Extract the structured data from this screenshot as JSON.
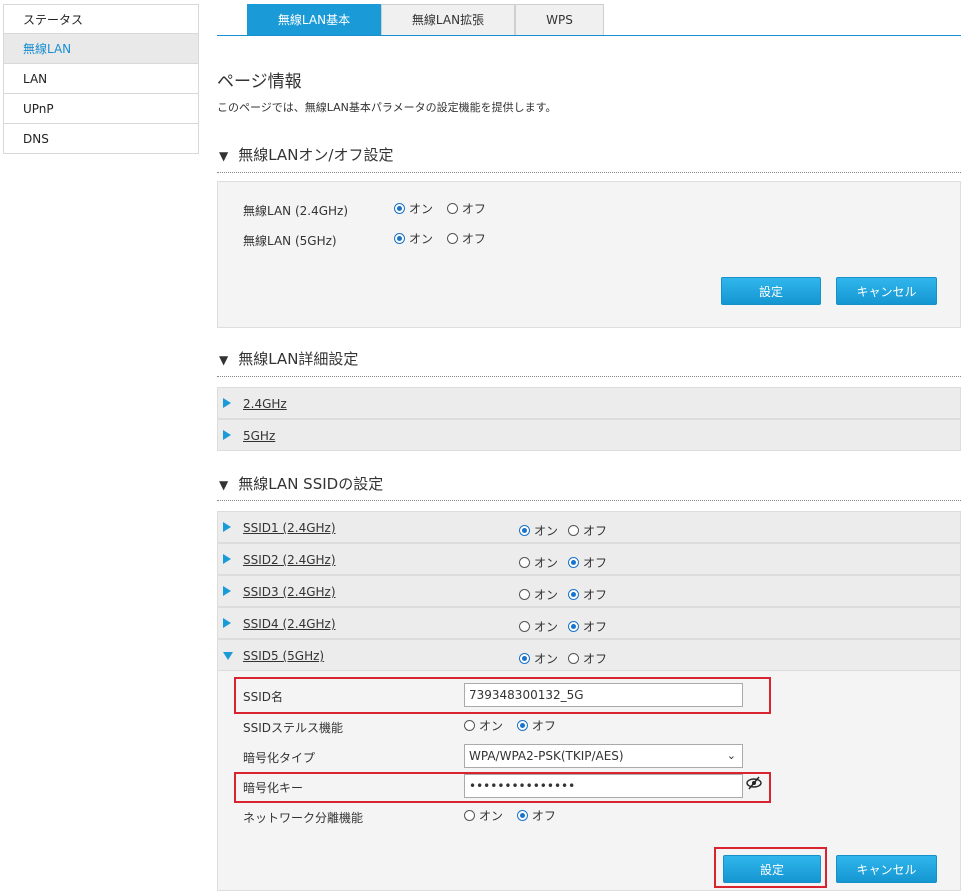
{
  "sidebar": {
    "items": [
      {
        "label": "ステータス"
      },
      {
        "label": "無線LAN"
      },
      {
        "label": "LAN"
      },
      {
        "label": "UPnP"
      },
      {
        "label": "DNS"
      }
    ]
  },
  "tabs": [
    {
      "label": "無線LAN基本"
    },
    {
      "label": "無線LAN拡張"
    },
    {
      "label": "WPS"
    }
  ],
  "page": {
    "title": "ページ情報",
    "description": "このページでは、無線LAN基本パラメータの設定機能を提供します。"
  },
  "onoff": {
    "title": "無線LANオン/オフ設定",
    "rows": [
      {
        "label": "無線LAN (2.4GHz)",
        "value": "on"
      },
      {
        "label": "無線LAN (5GHz)",
        "value": "on"
      }
    ],
    "on_label": "オン",
    "off_label": "オフ",
    "set_button": "設定",
    "cancel_button": "キャンセル"
  },
  "detail": {
    "title": "無線LAN詳細設定",
    "items": [
      {
        "label": "2.4GHz"
      },
      {
        "label": "5GHz"
      }
    ]
  },
  "ssid": {
    "title": "無線LAN SSIDの設定",
    "rows": [
      {
        "label": "SSID1 (2.4GHz)",
        "value": "on"
      },
      {
        "label": "SSID2 (2.4GHz)",
        "value": "off"
      },
      {
        "label": "SSID3 (2.4GHz)",
        "value": "off"
      },
      {
        "label": "SSID4 (2.4GHz)",
        "value": "off"
      },
      {
        "label": "SSID5 (5GHz)",
        "value": "on"
      }
    ],
    "form": {
      "ssid_name_label": "SSID名",
      "ssid_name_value": "739348300132_5G",
      "stealth_label": "SSIDステルス機能",
      "stealth_value": "off",
      "enc_type_label": "暗号化タイプ",
      "enc_type_value": "WPA/WPA2-PSK(TKIP/AES)",
      "enc_key_label": "暗号化キー",
      "enc_key_value": "•••••••••••••••",
      "isolation_label": "ネットワーク分離機能",
      "isolation_value": "off"
    },
    "set_button": "設定",
    "cancel_button": "キャンセル"
  },
  "colors": {
    "accent": "#1a9bd7",
    "highlight": "#d9232e"
  }
}
